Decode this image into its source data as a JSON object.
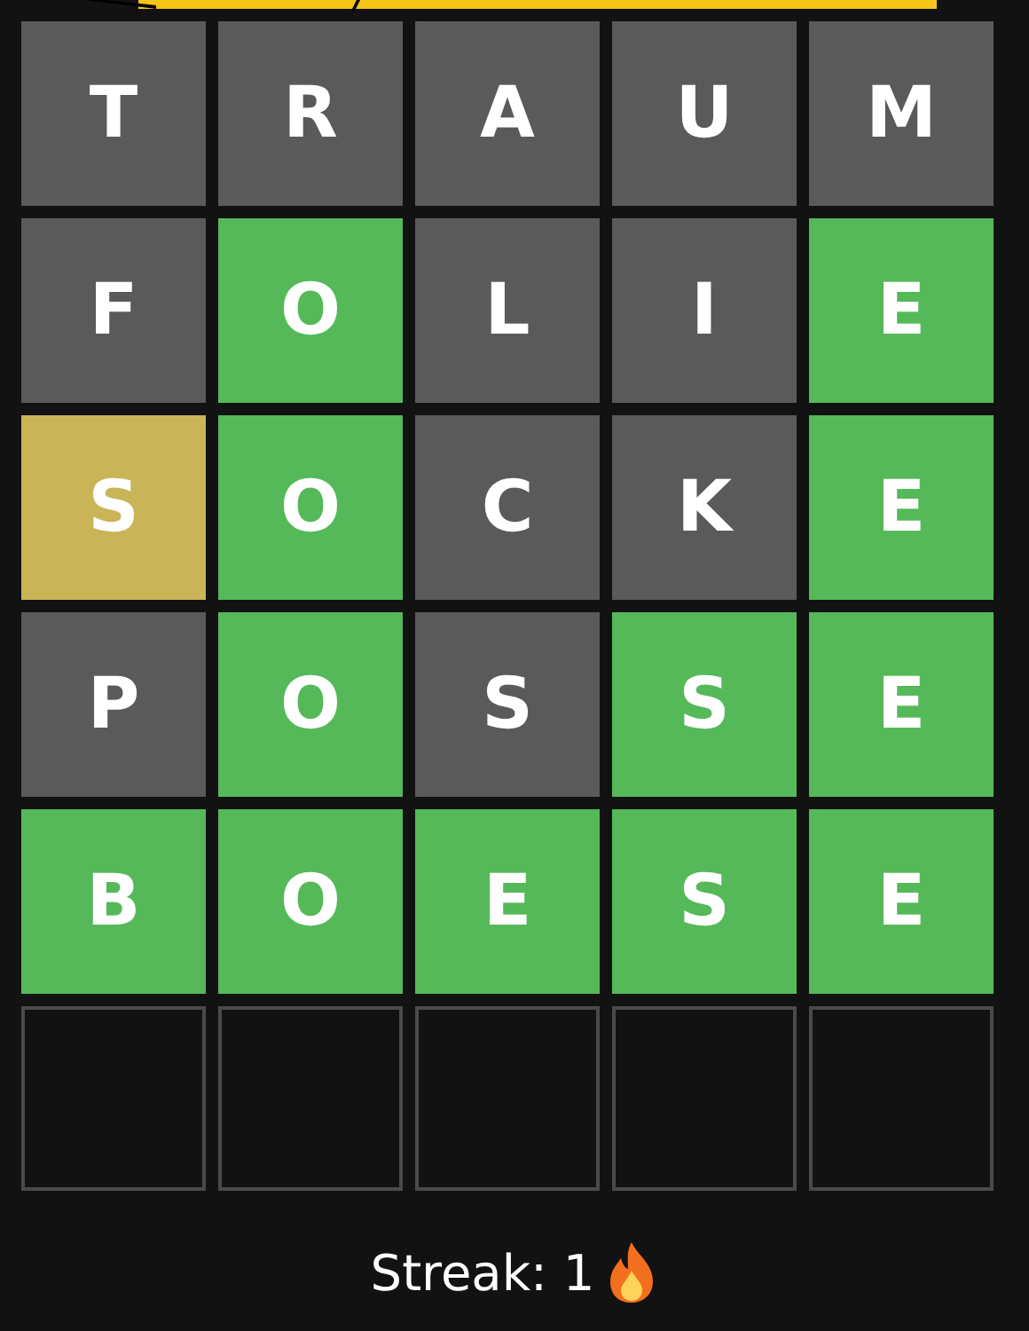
{
  "rows": [
    [
      {
        "letter": "T",
        "kind": "absent"
      },
      {
        "letter": "R",
        "kind": "absent"
      },
      {
        "letter": "A",
        "kind": "absent"
      },
      {
        "letter": "U",
        "kind": "absent"
      },
      {
        "letter": "M",
        "kind": "absent"
      }
    ],
    [
      {
        "letter": "F",
        "kind": "absent"
      },
      {
        "letter": "O",
        "kind": "correct"
      },
      {
        "letter": "L",
        "kind": "absent"
      },
      {
        "letter": "I",
        "kind": "absent"
      },
      {
        "letter": "E",
        "kind": "correct"
      }
    ],
    [
      {
        "letter": "S",
        "kind": "present"
      },
      {
        "letter": "O",
        "kind": "correct"
      },
      {
        "letter": "C",
        "kind": "absent"
      },
      {
        "letter": "K",
        "kind": "absent"
      },
      {
        "letter": "E",
        "kind": "correct"
      }
    ],
    [
      {
        "letter": "P",
        "kind": "absent"
      },
      {
        "letter": "O",
        "kind": "correct"
      },
      {
        "letter": "S",
        "kind": "absent"
      },
      {
        "letter": "S",
        "kind": "correct"
      },
      {
        "letter": "E",
        "kind": "correct"
      }
    ],
    [
      {
        "letter": "B",
        "kind": "correct"
      },
      {
        "letter": "O",
        "kind": "correct"
      },
      {
        "letter": "E",
        "kind": "correct"
      },
      {
        "letter": "S",
        "kind": "correct"
      },
      {
        "letter": "E",
        "kind": "correct"
      }
    ],
    [
      {
        "kind": "empty"
      },
      {
        "kind": "empty"
      },
      {
        "kind": "empty"
      },
      {
        "kind": "empty"
      },
      {
        "kind": "empty"
      }
    ]
  ],
  "streak": {
    "label": "Streak: 1"
  }
}
